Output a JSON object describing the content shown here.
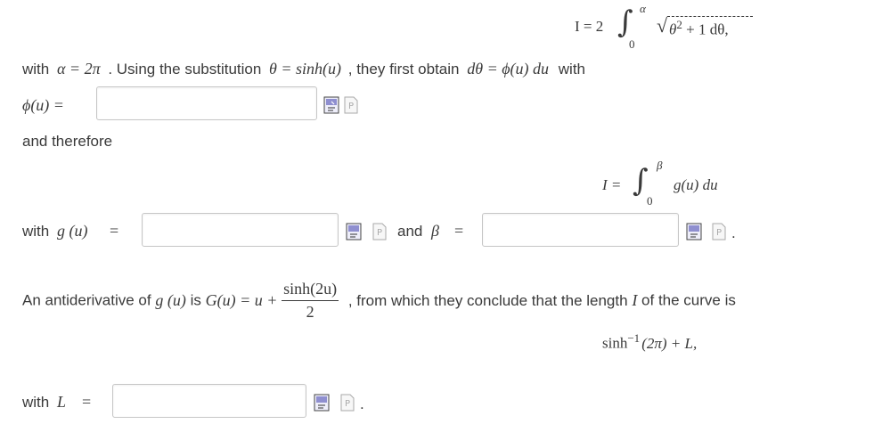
{
  "top_formula": {
    "lhs": "I = 2",
    "upper": "α",
    "lower": "0",
    "integrand_base": "θ",
    "integrand_exp": "2",
    "integrand_rest": " + 1 dθ,"
  },
  "line1": {
    "with": "with",
    "alpha_eq": "α = 2π",
    "text_a": ". Using the substitution",
    "subst": "θ = sinh(u)",
    "text_b": ", they first obtain",
    "dtheta": "dθ = ϕ(u) du",
    "text_c": "with"
  },
  "phi_row": {
    "label": "ϕ(u) =",
    "input_value": ""
  },
  "and_therefore": "and therefore",
  "second_formula": {
    "lhs": "I =",
    "upper": "β",
    "lower": "0",
    "integrand": "g(u) du"
  },
  "g_row": {
    "with": "with",
    "g_label": "g (u)",
    "eq": "=",
    "g_value": "",
    "and": "and",
    "beta": "β",
    "beta_eq": "=",
    "beta_value": "",
    "period": "."
  },
  "antiderivative": {
    "text_a": "An antiderivative of",
    "g_of_u": "g (u)",
    "is": "is",
    "G_expr": "G(u) = u +",
    "frac_num": "sinh(2u)",
    "frac_den": "2",
    "text_b": ", from which they conclude that the length",
    "I_var": "I",
    "text_c": "of the curve is"
  },
  "result": {
    "sinh": "sinh",
    "exp": "−1",
    "rest": "(2π) + L,"
  },
  "L_row": {
    "with": "with",
    "label": "L",
    "eq": "=",
    "input_value": "",
    "period": "."
  },
  "icons": {
    "preview": "equation-preview-icon",
    "palette": "formula-palette-icon",
    "accent": "#6b6bb3"
  }
}
